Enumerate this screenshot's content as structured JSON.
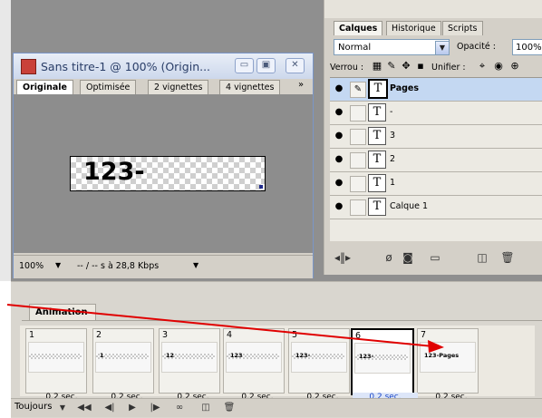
{
  "doc": {
    "title": "Sans titre-1 @ 100% (Origin...",
    "win_min": "▭",
    "win_max": "▣",
    "win_close": "✕",
    "tabs": [
      "Originale",
      "Optimisée",
      "2 vignettes",
      "4 vignettes"
    ],
    "tabs_more": "»",
    "canvas_text": "123-",
    "zoom": "100%",
    "speed": "-- / -- s à 28,8 Kbps"
  },
  "layers_panel": {
    "tabs": [
      "Calques",
      "Historique",
      "Scripts"
    ],
    "blend_mode": "Normal",
    "opacity_label": "Opacité :",
    "opacity_value": "100%",
    "lock_label": "Verrou :",
    "unify_label": "Unifier :",
    "layers": [
      {
        "name": "Pages",
        "selected": true
      },
      {
        "name": "-",
        "selected": false
      },
      {
        "name": "3",
        "selected": false
      },
      {
        "name": "2",
        "selected": false
      },
      {
        "name": "1",
        "selected": false
      },
      {
        "name": "Calque 1",
        "selected": false
      }
    ],
    "footer_icons": [
      "link-icon",
      "add-style-icon",
      "mask-icon",
      "group-icon",
      "new-layer-icon",
      "trash-icon"
    ]
  },
  "animation": {
    "tab": "Animation",
    "frames": [
      {
        "num": "1",
        "label": "",
        "delay": "0,2 sec."
      },
      {
        "num": "2",
        "label": "1",
        "delay": "0,2 sec."
      },
      {
        "num": "3",
        "label": "12",
        "delay": "0,2 sec."
      },
      {
        "num": "4",
        "label": "123",
        "delay": "0,2 sec."
      },
      {
        "num": "5",
        "label": "123-",
        "delay": "0,2 sec."
      },
      {
        "num": "6",
        "label": "123-",
        "delay": "0,2 sec."
      },
      {
        "num": "7",
        "label": "123-Pages",
        "delay": "0,2 sec."
      }
    ],
    "selected_frame": 6,
    "loop": "Toujours"
  },
  "colors": {
    "arrow": "#e00000",
    "selection": "#c4d8f2"
  }
}
